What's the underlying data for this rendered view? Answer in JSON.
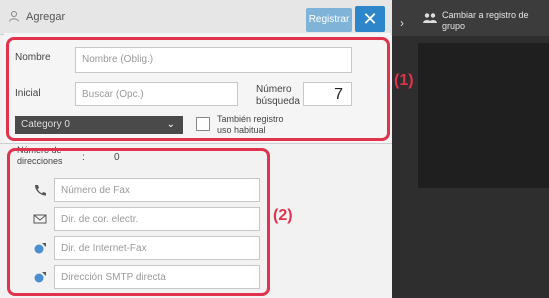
{
  "header": {
    "title": "Agregar",
    "register_label": "Registrar",
    "close_label": "✕"
  },
  "right_panel": {
    "group_register_label": "Cambiar a registro de grupo"
  },
  "form": {
    "name_label": "Nombre",
    "name_placeholder": "Nombre (Oblig.)",
    "initial_label": "Inicial",
    "initial_placeholder": "Buscar (Opc.)",
    "search_number_label_line1": "Número",
    "search_number_label_line2": "búsqueda",
    "search_number_value": "7",
    "category_value": "Category 0",
    "frequent_use_label_line1": "También registro",
    "frequent_use_label_line2": "uso habitual",
    "address_count_label_line1": "Número de",
    "address_count_label_line2": "direcciones",
    "address_count_sep": ":",
    "address_count_value": "0"
  },
  "addresses": [
    {
      "icon": "phone-icon",
      "placeholder": "Número de Fax"
    },
    {
      "icon": "envelope-icon",
      "placeholder": "Dir. de cor. electr."
    },
    {
      "icon": "globe-icon",
      "placeholder": "Dir. de Internet-Fax"
    },
    {
      "icon": "globe-icon",
      "placeholder": "Dirección SMTP directa"
    }
  ],
  "callouts": {
    "one": "(1)",
    "two": "(2)"
  },
  "colors": {
    "callout": "#e0334d",
    "accent_blue": "#2d86c9"
  }
}
